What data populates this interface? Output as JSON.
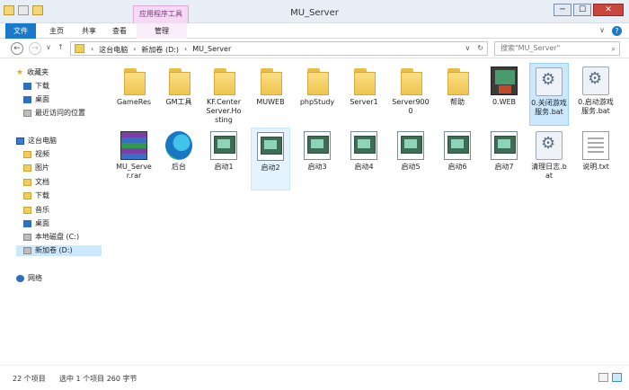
{
  "window": {
    "title": "MU_Server",
    "app_tool_tab": "应用程序工具",
    "buttons": [
      "─",
      "☐",
      "✕"
    ]
  },
  "ribbon": {
    "file": "文件",
    "home": "主页",
    "share": "共享",
    "view": "查看",
    "manage": "管理",
    "expand_glyph": "∨",
    "help_glyph": "?"
  },
  "address": {
    "back": "←",
    "forward": "→",
    "dropdown": "∨",
    "up": "↑",
    "crumbs": [
      "这台电脑",
      "新加卷 (D:)",
      "MU_Server"
    ],
    "separator": "›",
    "dropdown_glyph": "∨",
    "refresh_glyph": "↻"
  },
  "search": {
    "placeholder": "搜索\"MU_Server\"",
    "icon": "⌕"
  },
  "sidebar": {
    "favorites": "收藏夹",
    "fav_items": [
      "下载",
      "桌面",
      "最近访问的位置"
    ],
    "thispc": "这台电脑",
    "pc_items": [
      "视频",
      "图片",
      "文档",
      "下载",
      "音乐",
      "桌面",
      "本地磁盘 (C:)",
      "新加卷 (D:)"
    ],
    "network": "网络"
  },
  "files": {
    "row1": [
      "GameRes",
      "GM工具",
      "KF.CenterServer.Hosting",
      "MUWEB",
      "phpStudy",
      "Server1",
      "Server9000",
      "帮助",
      "0.WEB",
      "0.关闭游戏服务.bat",
      "0.启动游戏服务.bat"
    ],
    "row2": [
      "MU_Server.rar",
      "后台",
      "启动1",
      "启动2",
      "启动3",
      "启动4",
      "启动5",
      "启动6",
      "启动7",
      "清理日志.bat",
      "说明.txt"
    ]
  },
  "status": {
    "count": "22 个项目",
    "selected": "选中 1 个项目  260 字节"
  }
}
